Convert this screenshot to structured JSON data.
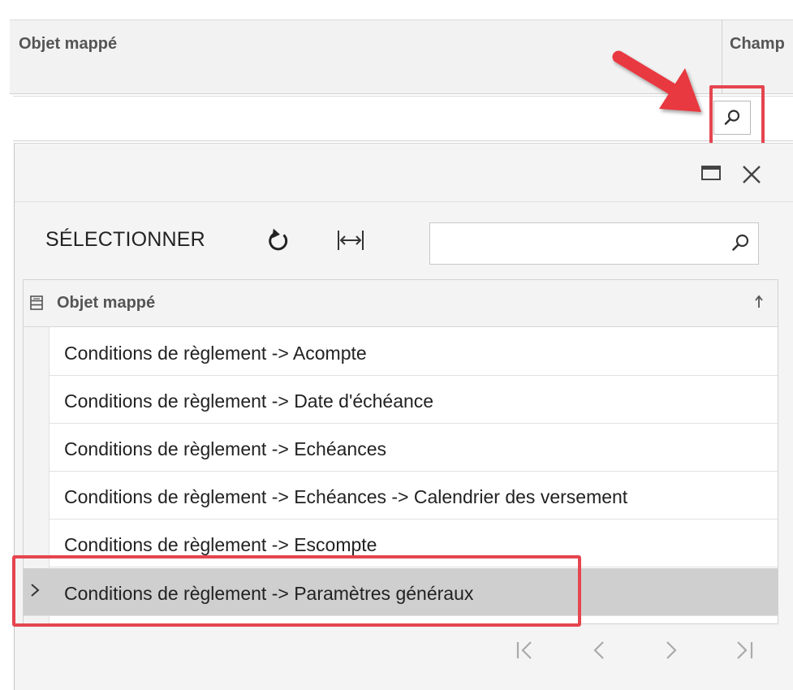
{
  "background_grid": {
    "columns": [
      "Objet mappé",
      "Champ"
    ]
  },
  "lookup": {
    "value": "",
    "icon": "search-icon"
  },
  "popup": {
    "window_buttons": [
      "maximize-icon",
      "close-icon"
    ],
    "toolbar": {
      "select_label": "SÉLECTIONNER",
      "refresh_icon": "refresh-icon",
      "fit_icon": "fit-columns-icon",
      "search_value": ""
    },
    "grid": {
      "column_header": "Objet mappé",
      "sort": "ascending",
      "rows": [
        "Conditions de règlement -> Acompte",
        "Conditions de règlement -> Date d'échéance",
        "Conditions de règlement -> Echéances",
        "Conditions de règlement -> Echéances -> Calendrier des versement",
        "Conditions de règlement -> Escompte",
        "Conditions de règlement -> Paramètres généraux"
      ],
      "selected_row_index": 5
    },
    "pager": [
      "first-page-icon",
      "previous-page-icon",
      "next-page-icon",
      "last-page-icon"
    ]
  },
  "colors": {
    "highlight": "#e5454f",
    "selected_row": "#cfcfcf",
    "header_bg": "#f2f2f2"
  }
}
